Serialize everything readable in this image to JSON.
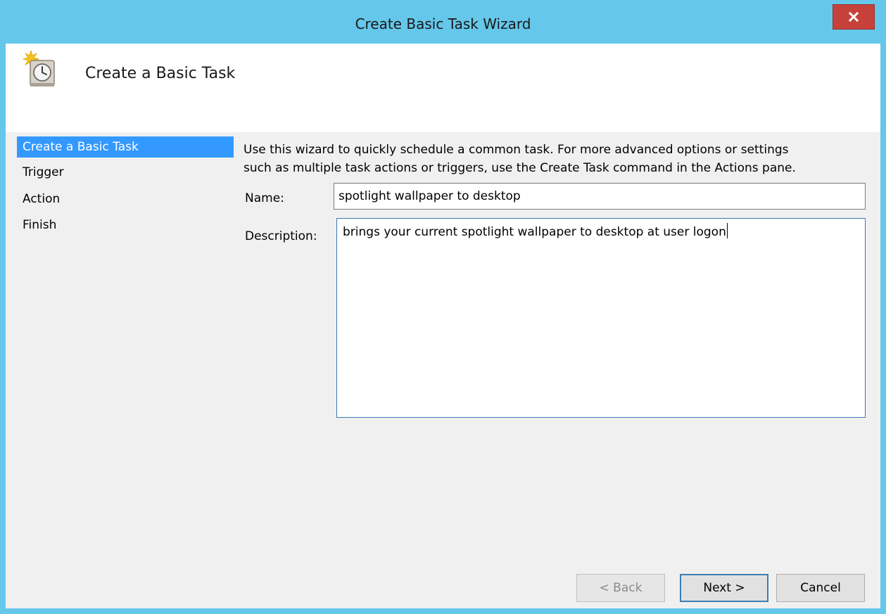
{
  "window": {
    "title": "Create Basic Task Wizard"
  },
  "header": {
    "title": "Create a Basic Task",
    "icon": "task-scheduler-clock-icon"
  },
  "steps": [
    {
      "label": "Create a Basic Task",
      "active": true
    },
    {
      "label": "Trigger",
      "active": false
    },
    {
      "label": "Action",
      "active": false
    },
    {
      "label": "Finish",
      "active": false
    }
  ],
  "content": {
    "intro_line1": "Use this wizard to quickly schedule a common task.  For more advanced options or settings",
    "intro_line2": "such as multiple task actions or triggers, use the Create Task command in the Actions pane.",
    "name_label": "Name:",
    "name_value": "spotlight wallpaper to desktop",
    "description_label": "Description:",
    "description_value": "brings your current spotlight wallpaper to desktop at user logon"
  },
  "buttons": {
    "back": "< Back",
    "next": "Next >",
    "cancel": "Cancel"
  },
  "colors": {
    "titlebar": "#65c7ea",
    "close": "#c7413b",
    "selection": "#3399ff"
  }
}
